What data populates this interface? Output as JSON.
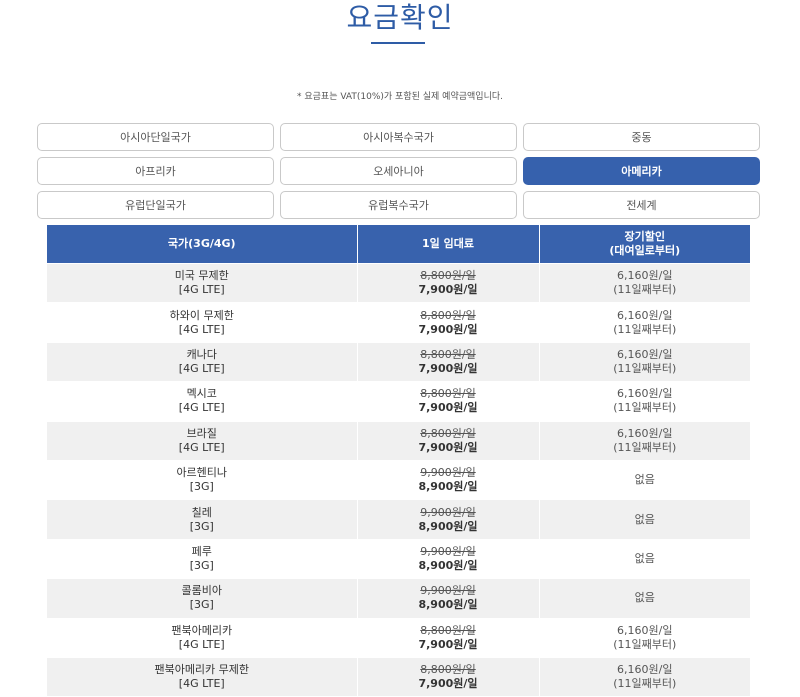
{
  "page": {
    "title": "요금확인",
    "notice": "* 요금표는 VAT(10%)가 포함된 실제 예약금액입니다."
  },
  "regions": [
    {
      "label": "아시아단일국가",
      "active": false
    },
    {
      "label": "아시아복수국가",
      "active": false
    },
    {
      "label": "중동",
      "active": false
    },
    {
      "label": "아프리카",
      "active": false
    },
    {
      "label": "오세아니아",
      "active": false
    },
    {
      "label": "아메리카",
      "active": true
    },
    {
      "label": "유럽단일국가",
      "active": false
    },
    {
      "label": "유럽복수국가",
      "active": false
    },
    {
      "label": "전세계",
      "active": false
    }
  ],
  "table": {
    "headers": {
      "country": "국가(3G/4G)",
      "daily": "1일 임대료",
      "longterm_line1": "장기할인",
      "longterm_line2": "(대여일로부터)"
    },
    "rows": [
      {
        "country": "미국 무제한",
        "network": "[4G LTE]",
        "orig": "8,800원/일",
        "sale": "7,900원/일",
        "discount": "6,160원/일",
        "discount_note": "(11일째부터)"
      },
      {
        "country": "하와이 무제한",
        "network": "[4G LTE]",
        "orig": "8,800원/일",
        "sale": "7,900원/일",
        "discount": "6,160원/일",
        "discount_note": "(11일째부터)"
      },
      {
        "country": "캐나다",
        "network": "[4G LTE]",
        "orig": "8,800원/일",
        "sale": "7,900원/일",
        "discount": "6,160원/일",
        "discount_note": "(11일째부터)"
      },
      {
        "country": "멕시코",
        "network": "[4G LTE]",
        "orig": "8,800원/일",
        "sale": "7,900원/일",
        "discount": "6,160원/일",
        "discount_note": "(11일째부터)"
      },
      {
        "country": "브라질",
        "network": "[4G LTE]",
        "orig": "8,800원/일",
        "sale": "7,900원/일",
        "discount": "6,160원/일",
        "discount_note": "(11일째부터)"
      },
      {
        "country": "아르헨티나",
        "network": "[3G]",
        "orig": "9,900원/일",
        "sale": "8,900원/일",
        "discount": "없음",
        "discount_note": ""
      },
      {
        "country": "칠레",
        "network": "[3G]",
        "orig": "9,900원/일",
        "sale": "8,900원/일",
        "discount": "없음",
        "discount_note": ""
      },
      {
        "country": "페루",
        "network": "[3G]",
        "orig": "9,900원/일",
        "sale": "8,900원/일",
        "discount": "없음",
        "discount_note": ""
      },
      {
        "country": "콜롬비아",
        "network": "[3G]",
        "orig": "9,900원/일",
        "sale": "8,900원/일",
        "discount": "없음",
        "discount_note": ""
      },
      {
        "country": "팬북아메리카",
        "network": "[4G LTE]",
        "orig": "8,800원/일",
        "sale": "7,900원/일",
        "discount": "6,160원/일",
        "discount_note": "(11일째부터)"
      },
      {
        "country": "팬북아메리카 무제한",
        "network": "[4G LTE]",
        "orig": "8,800원/일",
        "sale": "7,900원/일",
        "discount": "6,160원/일",
        "discount_note": "(11일째부터)"
      }
    ]
  },
  "colors": {
    "accent": "#3661ad",
    "header_bg": "#3862ad",
    "row_alt": "#f0f0f0"
  }
}
